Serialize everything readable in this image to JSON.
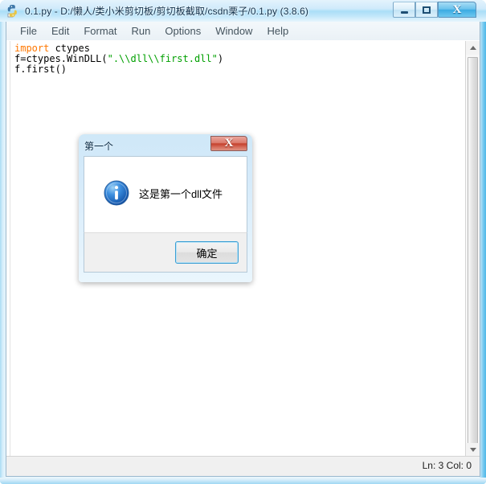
{
  "window": {
    "title": "0.1.py - D:/懒人/类小米剪切板/剪切板截取/csdn栗子/0.1.py (3.8.6)",
    "icon": "python-idle-icon",
    "controls": {
      "minimize_label": "–",
      "maximize_label": "□",
      "close_label": "X"
    }
  },
  "menubar": {
    "items": [
      {
        "label": "File"
      },
      {
        "label": "Edit"
      },
      {
        "label": "Format"
      },
      {
        "label": "Run"
      },
      {
        "label": "Options"
      },
      {
        "label": "Window"
      },
      {
        "label": "Help"
      }
    ]
  },
  "editor": {
    "lines": [
      {
        "tokens": [
          {
            "text": "import",
            "kind": "keyword"
          },
          {
            "text": " ctypes",
            "kind": "plain"
          }
        ]
      },
      {
        "tokens": [
          {
            "text": "f=ctypes.WinDLL(",
            "kind": "plain"
          },
          {
            "text": "\".\\\\dll\\\\first.dll\"",
            "kind": "string"
          },
          {
            "text": ")",
            "kind": "plain"
          }
        ]
      },
      {
        "tokens": [
          {
            "text": "f.first()",
            "kind": "plain"
          }
        ]
      }
    ],
    "colors": {
      "keyword": "#ff7700",
      "string": "#00a000",
      "plain": "#000000",
      "background": "#ffffff"
    }
  },
  "statusbar": {
    "position_text": "Ln: 3   Col: 0",
    "line": "3",
    "column": "0"
  },
  "dialog": {
    "title": "第一个",
    "message": "这是第一个dll文件",
    "icon": "info-icon",
    "ok_label": "确定",
    "close_label": "X"
  },
  "scrollbar": {
    "up_arrow": "scroll-up-arrow",
    "down_arrow": "scroll-down-arrow"
  }
}
